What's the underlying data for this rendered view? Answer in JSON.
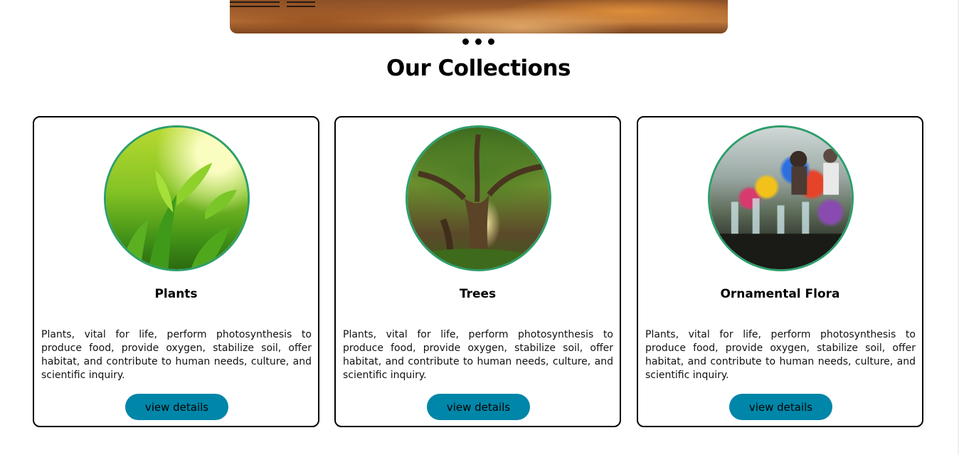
{
  "slider": {
    "image_icon": "autumn-park-path-image",
    "dots_count": 3
  },
  "collections": {
    "heading": "Our Collections",
    "cards": [
      {
        "title": "Plants",
        "image_icon": "plants-leaves-image",
        "description": "Plants, vital for life, perform photosynthesis to produce food, provide oxygen, stabilize soil, offer habitat, and contribute to human needs, culture, and scientific inquiry.",
        "button_label": "view details"
      },
      {
        "title": "Trees",
        "image_icon": "large-tree-image",
        "description": "Plants, vital for life, perform photosynthesis to produce food, provide oxygen, stabilize soil, offer habitat, and contribute to human needs, culture, and scientific inquiry.",
        "button_label": "view details"
      },
      {
        "title": "Ornamental Flora",
        "image_icon": "flower-market-image",
        "description": "Plants, vital for life, perform photosynthesis to produce food, provide oxygen, stabilize soil, offer habitat, and contribute to human needs, culture, and scientific inquiry.",
        "button_label": "view details"
      }
    ]
  },
  "colors": {
    "button_bg": "#0086a8",
    "thumb_border": "#2e9e6b",
    "card_border": "#000000"
  }
}
